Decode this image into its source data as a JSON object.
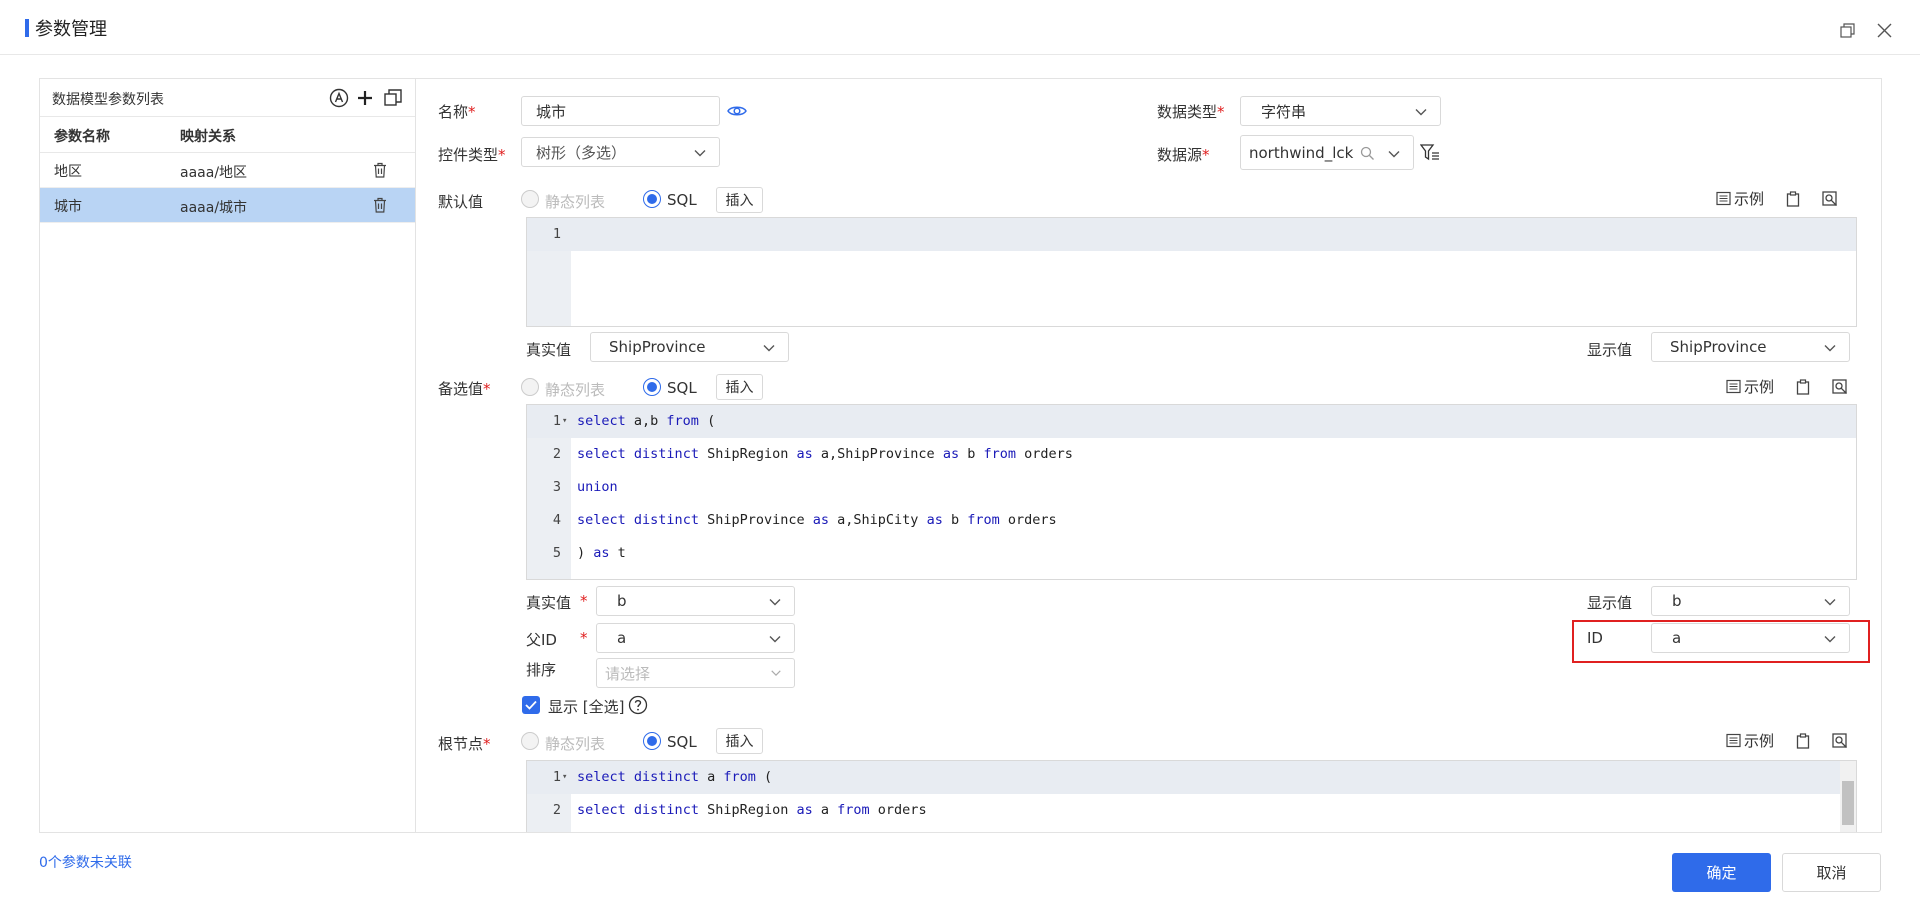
{
  "dialog": {
    "title": "参数管理"
  },
  "left_panel": {
    "title": "数据模型参数列表",
    "columns": [
      "参数名称",
      "映射关系"
    ],
    "rows": [
      {
        "name": "地区",
        "mapping": "aaaa/地区",
        "selected": false
      },
      {
        "name": "城市",
        "mapping": "aaaa/城市",
        "selected": true
      }
    ]
  },
  "form": {
    "name_label": "名称",
    "name_value": "城市",
    "data_type_label": "数据类型",
    "data_type_value": "字符串",
    "control_type_label": "控件类型",
    "control_type_value": "树形（多选）",
    "data_source_label": "数据源",
    "data_source_value": "northwind_lck",
    "default_label": "默认值",
    "candidate_label": "备选值",
    "root_label": "根节点",
    "static_list": "静态列表",
    "sql": "SQL",
    "insert": "插入",
    "example": "示例",
    "default_real_label": "真实值",
    "default_real_value": "ShipProvince",
    "default_display_label": "显示值",
    "default_display_value": "ShipProvince",
    "cand_real_label": "真实值",
    "cand_real_value": "b",
    "cand_display_label": "显示值",
    "cand_display_value": "b",
    "parent_id_label": "父ID",
    "parent_id_value": "a",
    "id_label": "ID",
    "id_value": "a",
    "sort_label": "排序",
    "sort_placeholder": "请选择",
    "show_all_label": "显示 [全选]",
    "show_all_checked": true
  },
  "default_editor": {
    "lines": [
      "1"
    ]
  },
  "candidate_editor": {
    "lines": [
      {
        "n": "1",
        "code": "select a,b from ("
      },
      {
        "n": "2",
        "code": "select distinct ShipRegion as a,ShipProvince as b from orders"
      },
      {
        "n": "3",
        "code": "union"
      },
      {
        "n": "4",
        "code": "select distinct ShipProvince as a,ShipCity as b from orders"
      },
      {
        "n": "5",
        "code": ") as t"
      }
    ]
  },
  "root_editor": {
    "lines": [
      {
        "n": "1",
        "code": "select distinct a from ("
      },
      {
        "n": "2",
        "code": "select distinct ShipRegion as a from orders"
      }
    ]
  },
  "footer": {
    "unlinked": "0个参数未关联",
    "ok": "确定",
    "cancel": "取消"
  },
  "colors": {
    "accent": "#2f6bea",
    "highlight": "#e02020",
    "selected_row": "#b9d4f4"
  }
}
